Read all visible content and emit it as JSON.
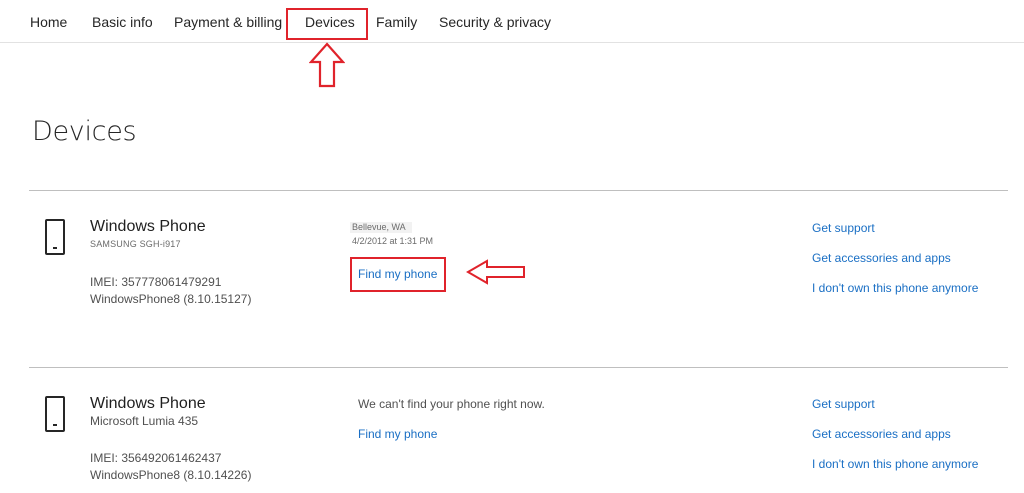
{
  "nav": {
    "items": [
      {
        "label": "Home"
      },
      {
        "label": "Basic info"
      },
      {
        "label": "Payment & billing"
      },
      {
        "label": "Devices"
      },
      {
        "label": "Family"
      },
      {
        "label": "Security & privacy"
      }
    ]
  },
  "page": {
    "title": "Devices"
  },
  "devices": [
    {
      "name": "Windows Phone",
      "model": "SAMSUNG SGH-i917",
      "imei": "IMEI: 357778061479291",
      "os": "WindowsPhone8 (8.10.15127)",
      "location": "Bellevue, WA",
      "timestamp": "4/2/2012 at 1:31 PM",
      "find_label": "Find my phone",
      "links": [
        "Get support",
        "Get accessories and apps",
        "I don't own this phone anymore"
      ]
    },
    {
      "name": "Windows Phone",
      "model": "Microsoft Lumia 435",
      "imei": "IMEI: 356492061462437",
      "os": "WindowsPhone8 (8.10.14226)",
      "status": "We can't find your phone right now.",
      "find_label": "Find my phone",
      "links": [
        "Get support",
        "Get accessories and apps",
        "I don't own this phone anymore"
      ]
    }
  ],
  "colors": {
    "accent": "#1a6fc4",
    "annotation": "#e0232b",
    "text": "#262626"
  },
  "icons": {
    "device": "phone-icon",
    "annotation_up": "up-arrow-icon",
    "annotation_left": "left-arrow-icon"
  }
}
